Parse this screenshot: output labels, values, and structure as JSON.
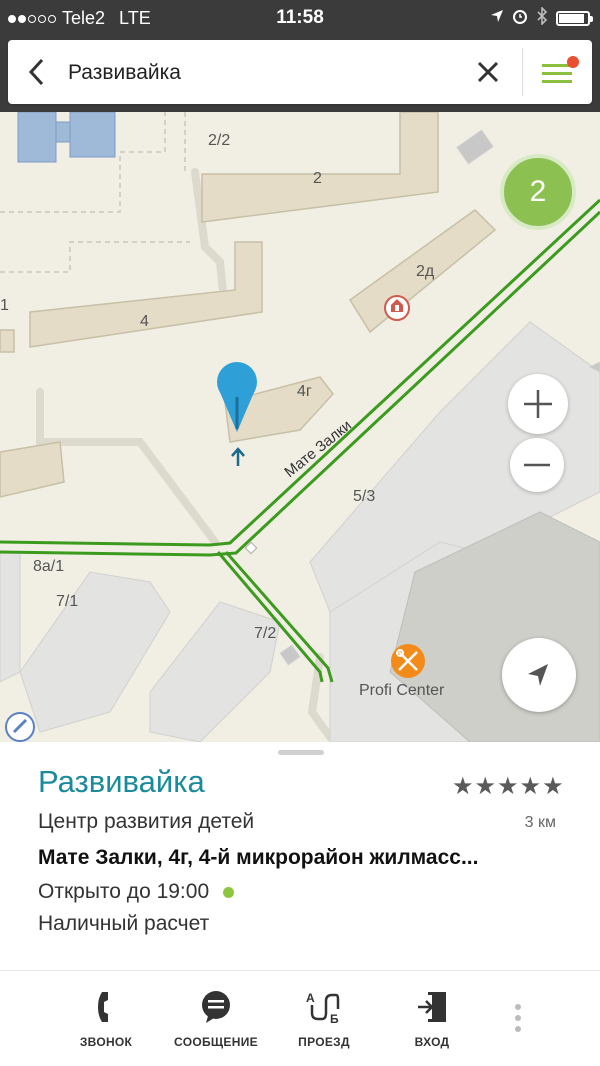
{
  "status_bar": {
    "carrier": "Tele2",
    "network": "LTE",
    "time": "11:58",
    "signal_bars": 2,
    "signal_total": 5,
    "battery_level": 0.9
  },
  "search": {
    "query": "Развивайка"
  },
  "map": {
    "building_labels": [
      "2/2",
      "2",
      "2д",
      "4",
      "4г",
      "5/3",
      "8а/1",
      "7/1",
      "7/2",
      "1"
    ],
    "road_name": "Мате Залки",
    "poi_label": "Profi Center",
    "cluster_count": "2",
    "colors": {
      "road": "#3c9b1f",
      "building": "#e4dcc6",
      "lot": "#e3e4e2",
      "pin": "#2f9fd8",
      "poi": "#f28b1a"
    }
  },
  "card": {
    "title": "Развивайка",
    "rating_stars": "★★★★★",
    "category": "Центр развития детей",
    "distance": "3 км",
    "address": "Мате Залки, 4г, 4-й микрорайон жилмасс...",
    "hours": "Открыто до 19:00",
    "payment": "Наличный расчет"
  },
  "toolbar": {
    "call": "ЗВОНОК",
    "message": "СООБЩЕНИЕ",
    "route": "ПРОЕЗД",
    "entrance": "ВХОД"
  }
}
